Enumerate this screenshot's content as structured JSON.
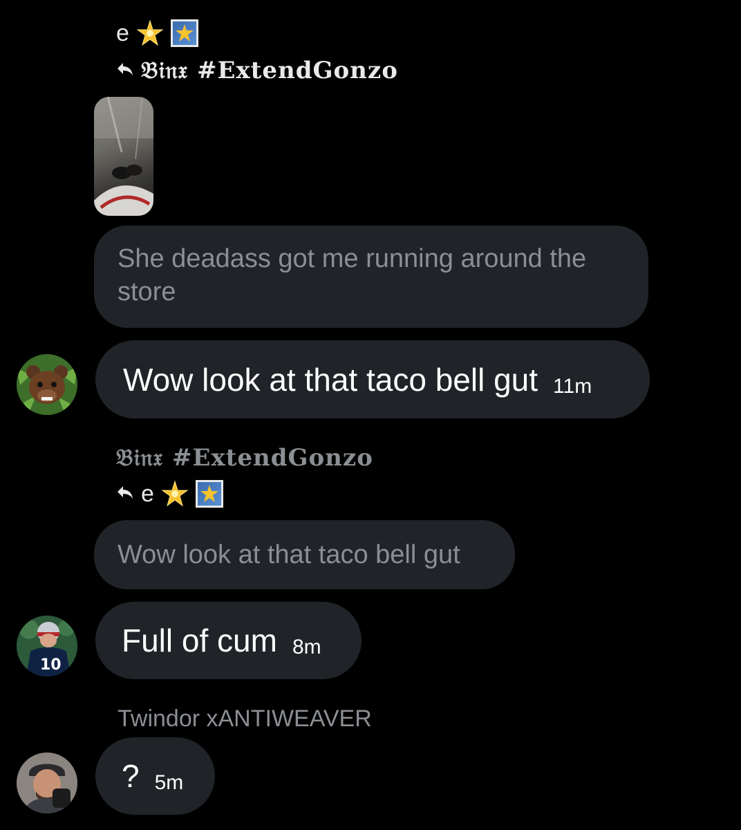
{
  "messages": [
    {
      "reply_to": {
        "top_name": "e",
        "arrow_name": "𝔅𝔦𝔫𝔵 #ExtendGonzo"
      },
      "quoted_text": "She deadass got me running around the store",
      "text": "Wow look at that taco bell gut",
      "time": "11m",
      "avatar_icon": "bear-avatar"
    },
    {
      "reply_to": {
        "top_name": "𝔅𝔦𝔫𝔵 #ExtendGonzo",
        "arrow_name": "e"
      },
      "quoted_text": "Wow look at that taco bell gut",
      "text": "Full of cum",
      "time": "8m",
      "avatar_icon": "football-player-avatar"
    },
    {
      "author": "Twindor xANTIWEAVER",
      "text": "?",
      "time": "5m",
      "avatar_icon": "man-avatar"
    }
  ],
  "colors": {
    "background": "#000000",
    "bubble": "#202327",
    "muted_text": "#8b8f94",
    "text": "#ffffff"
  }
}
